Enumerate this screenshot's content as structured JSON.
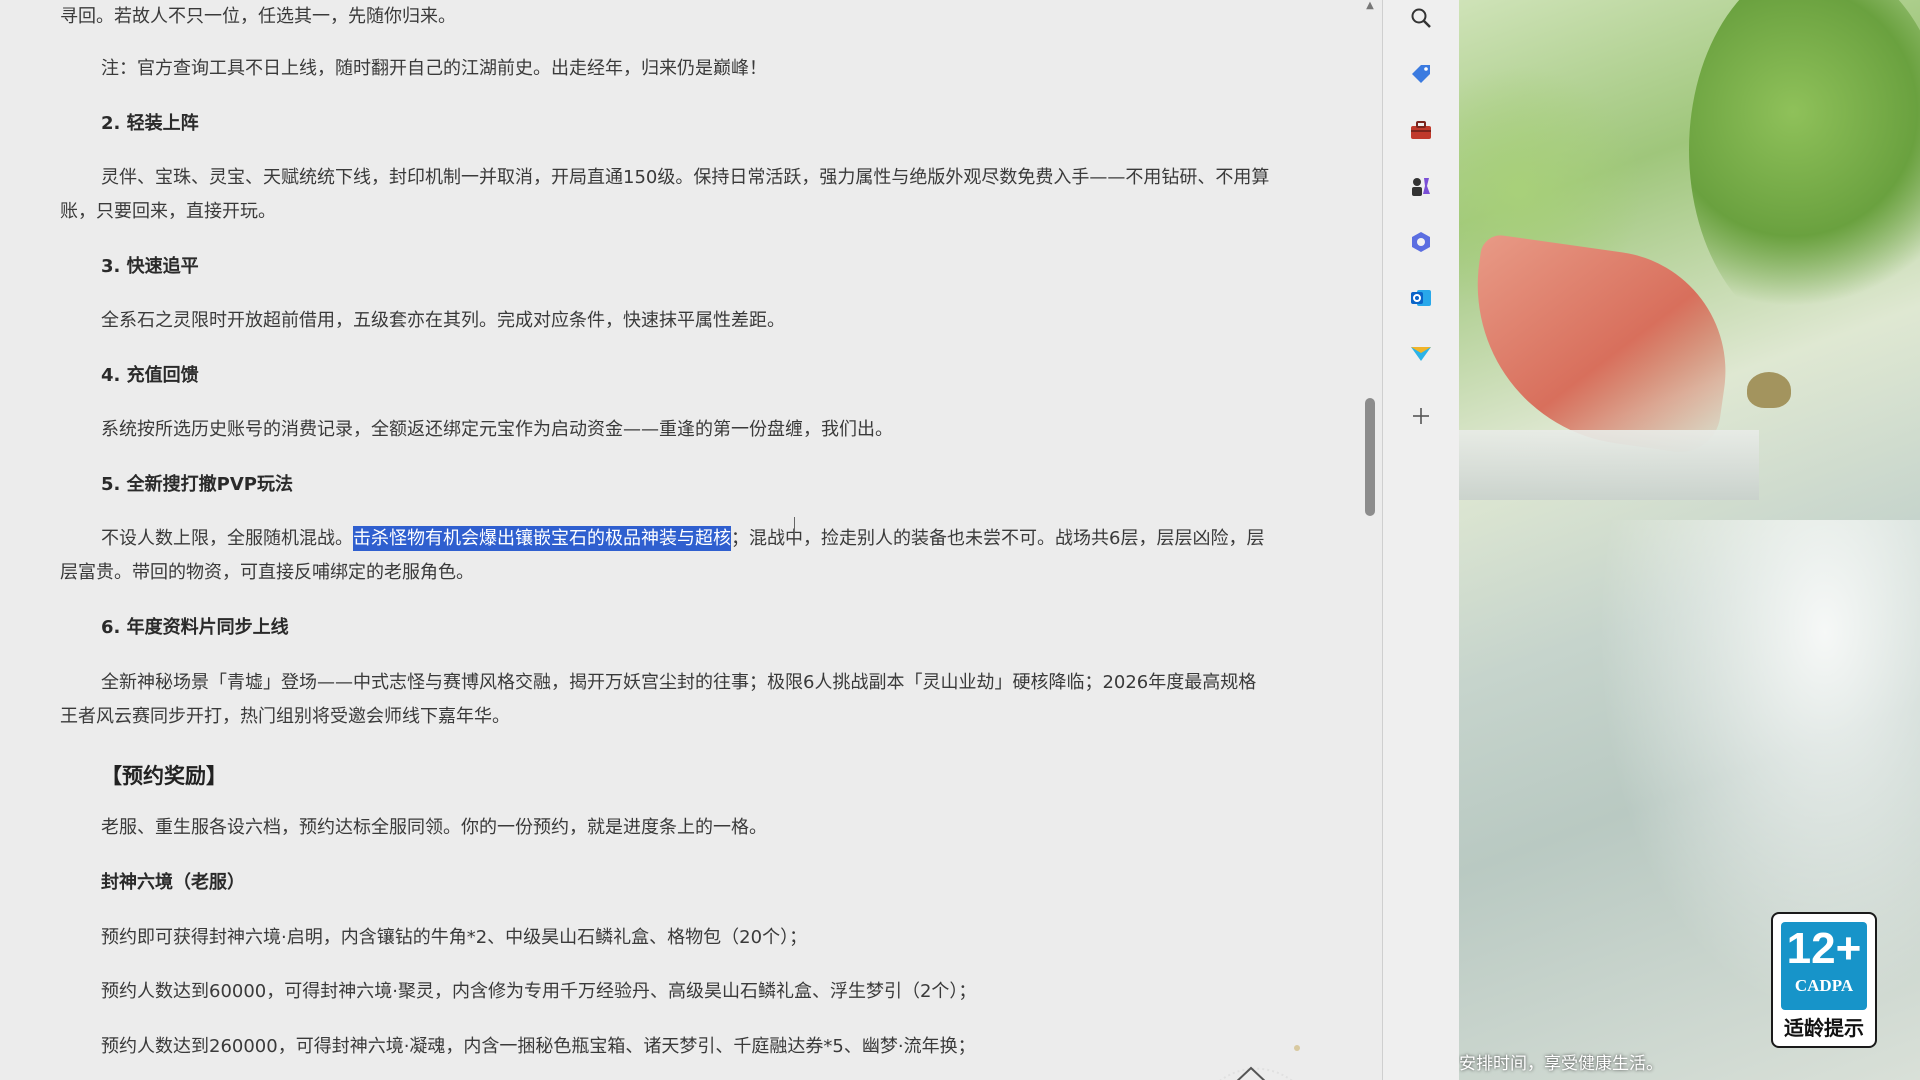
{
  "article": {
    "top_fragment": "寻回。若故人不只一位，任选其一，先随你归来。",
    "note": "注：官方查询工具不日上线，随时翻开自己的江湖前史。出走经年，归来仍是巅峰！",
    "h2": "2. 轻装上阵",
    "p2": "灵伴、宝珠、灵宝、天赋统统下线，封印机制一并取消，开局直通150级。保持日常活跃，强力属性与绝版外观尽数免费入手——不用钻研、不用算账，只要回来，直接开玩。",
    "h3": "3. 快速追平",
    "p3": "全系石之灵限时开放超前借用，五级套亦在其列。完成对应条件，快速抹平属性差距。",
    "h4": "4. 充值回馈",
    "p4": "系统按所选历史账号的消费记录，全额返还绑定元宝作为启动资金——重逢的第一份盘缠，我们出。",
    "h5": "5. 全新搜打撤PVP玩法",
    "p5_before": "不设人数上限，全服随机混战。",
    "p5_selected": "击杀怪物有机会爆出镶嵌宝石的极品神装与超核",
    "p5_after": "；混战中，捡走别人的装备也未尝不可。战场共6层，层层凶险，层层富贵。带回的物资，可直接反哺绑定的老服角色。",
    "h6": "6. 年度资料片同步上线",
    "p6": "全新神秘场景「青墟」登场——中式志怪与赛博风格交融，揭开万妖宫尘封的往事；极限6人挑战副本「灵山业劫」硬核降临；2026年度最高规格王者风云赛同步开打，热门组别将受邀会师线下嘉年华。",
    "section_rewards": "【预约奖励】",
    "p_rewards": "老服、重生服各设六档，预约达标全服同领。你的一份预约，就是进度条上的一格。",
    "h_fengshen": "封神六境（老服）",
    "r1": "预约即可获得封神六境·启明，内含镶钻的牛角*2、中级昊山石鳞礼盒、格物包（20个）；",
    "r2": "预约人数达到60000，可得封神六境·聚灵，内含修为专用千万经验丹、高级昊山石鳞礼盒、浮生梦引（2个）；",
    "r3": "预约人数达到260000，可得封神六境·凝魂，内含一捆秘色瓶宝箱、诸天梦引、千庭融达券*5、幽梦·流年换；"
  },
  "sidebar": {
    "icons": [
      "search-icon",
      "tag-icon",
      "toolbox-icon",
      "chess-icon",
      "copilot-icon",
      "outlook-icon",
      "send-icon",
      "add-icon"
    ]
  },
  "badge": {
    "age": "12+",
    "org": "CADPA",
    "tip": "适龄提示"
  },
  "footer_notice": "安排时间，享受健康生活。",
  "colors": {
    "selection": "#2f5fcf",
    "background": "#ececec",
    "badge_blue": "#1794c9"
  }
}
